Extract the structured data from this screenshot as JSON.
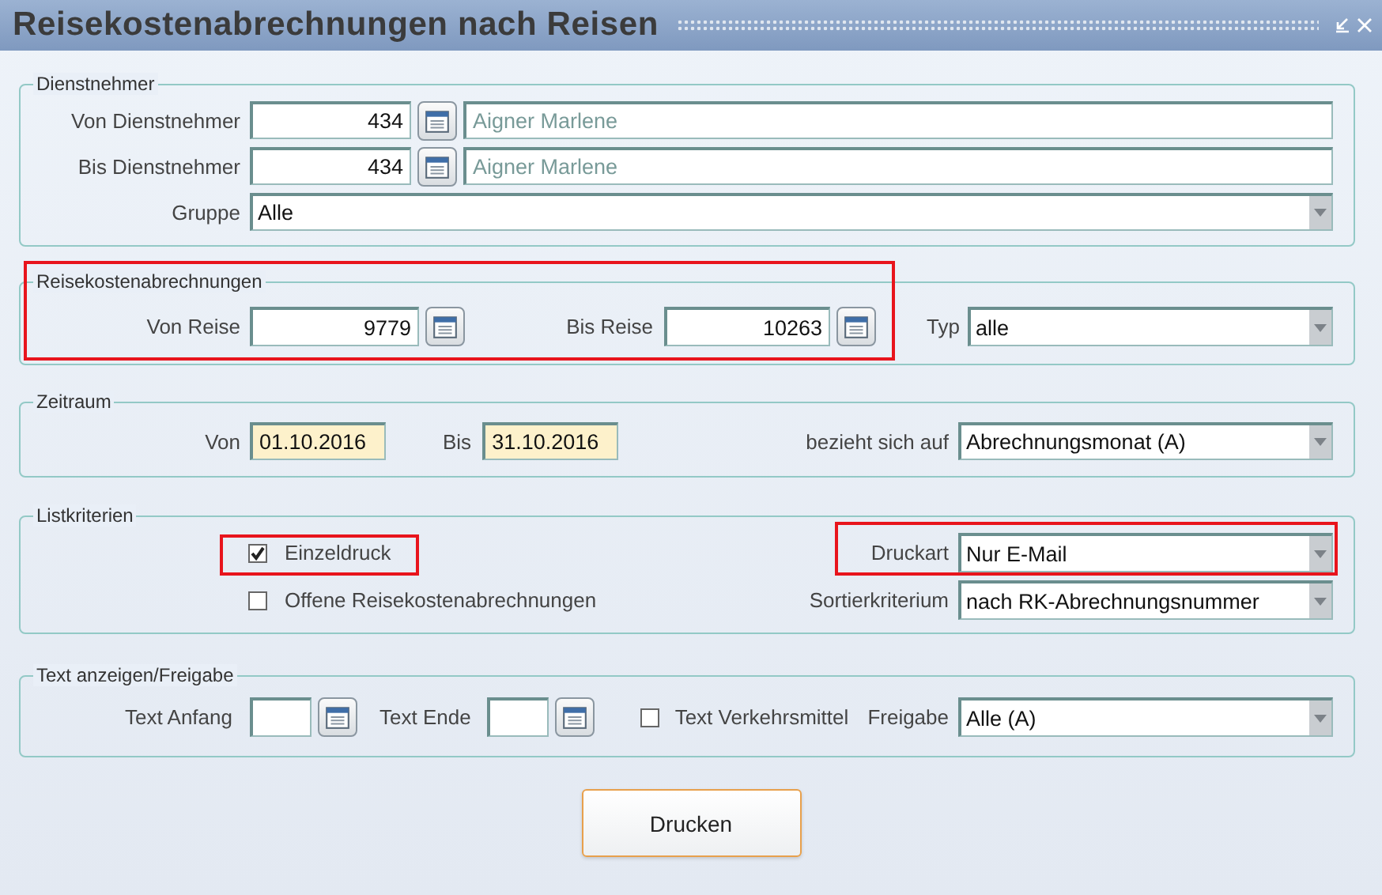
{
  "window": {
    "title": "Reisekostenabrechnungen nach Reisen"
  },
  "employees": {
    "legend": "Dienstnehmer",
    "rows": [
      {
        "label": "Von Dienstnehmer",
        "number": "434",
        "name": "Aigner Marlene"
      },
      {
        "label": "Bis Dienstnehmer",
        "number": "434",
        "name": "Aigner Marlene"
      }
    ],
    "group": {
      "label": "Gruppe",
      "value": "Alle"
    }
  },
  "trips": {
    "legend": "Reisekostenabrechnungen",
    "highlighted": true,
    "from": {
      "label": "Von Reise",
      "value": "9779"
    },
    "to": {
      "label": "Bis Reise",
      "value": "10263"
    },
    "type": {
      "label": "Typ",
      "value": "alle"
    }
  },
  "period": {
    "legend": "Zeitraum",
    "from": {
      "label": "Von",
      "value": "01.10.2016"
    },
    "to": {
      "label": "Bis",
      "value": "31.10.2016"
    },
    "refers": {
      "label": "bezieht sich auf",
      "value": "Abrechnungsmonat (A)"
    }
  },
  "list_criteria": {
    "legend": "Listkriterien",
    "checkboxes": [
      {
        "label": "Einzeldruck",
        "checked": true,
        "highlighted": true
      },
      {
        "label": "Offene Reisekostenabrechnungen",
        "checked": false,
        "highlighted": false
      }
    ],
    "selects": [
      {
        "label": "Druckart",
        "value": "Nur E-Mail",
        "highlighted": true
      },
      {
        "label": "Sortierkriterium",
        "value": "nach RK-Abrechnungsnummer",
        "highlighted": false
      }
    ]
  },
  "text_release": {
    "legend": "Text anzeigen/Freigabe",
    "start": {
      "label": "Text Anfang"
    },
    "end": {
      "label": "Text Ende"
    },
    "transport": {
      "label": "Text Verkehrsmittel",
      "checked": false
    },
    "release": {
      "label": "Freigabe",
      "value": "Alle (A)"
    }
  },
  "print_button": "Drucken"
}
